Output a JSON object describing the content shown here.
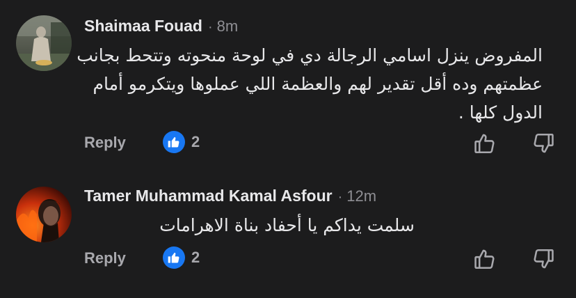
{
  "comments": [
    {
      "author": "Shaimaa Fouad",
      "separator": "·",
      "time": "8m",
      "text": "المفروض ينزل اسامي الرجالة دي في لوحة منحوته وتتحط بجانب عظمتهم وده أقل تقدير لهم والعظمة اللي عملوها ويتكرمو أمام الدول كلها .",
      "reply_label": "Reply",
      "reaction_icon": "like-icon",
      "reaction_count": "2"
    },
    {
      "author": "Tamer Muhammad Kamal Asfour",
      "separator": "·",
      "time": "12m",
      "text": "سلمت يداكم يا أحفاد بناة الاهرامات",
      "reply_label": "Reply",
      "reaction_icon": "like-icon",
      "reaction_count": "2"
    }
  ],
  "colors": {
    "background": "#1c1c1d",
    "text_primary": "#e8e8ea",
    "text_secondary": "#8e8e93",
    "like_blue": "#1877f2"
  }
}
